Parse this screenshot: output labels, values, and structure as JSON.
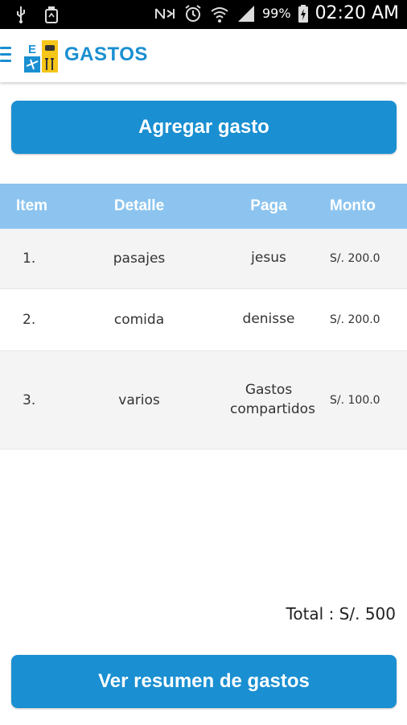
{
  "status_bar": {
    "battery_percent": "99%",
    "time": "02:20 AM",
    "icons": [
      "usb-icon",
      "recycle-icon",
      "nfc-icon",
      "alarm-icon",
      "wifi-icon",
      "signal-icon",
      "battery-icon"
    ]
  },
  "app_bar": {
    "title": "GASTOS",
    "logo_letter": "E",
    "accent_color": "#1a8fd1"
  },
  "actions": {
    "add_label": "Agregar gasto",
    "summary_label": "Ver resumen de gastos"
  },
  "table": {
    "header_color": "#8cc4ef",
    "headers": {
      "item": "Item",
      "detalle": "Detalle",
      "paga": "Paga",
      "monto": "Monto"
    },
    "rows": [
      {
        "item": "1.",
        "detalle": "pasajes",
        "paga": "jesus",
        "monto": "S/. 200.0"
      },
      {
        "item": "2.",
        "detalle": "comida",
        "paga": "denisse",
        "monto": "S/. 200.0"
      },
      {
        "item": "3.",
        "detalle": "varios",
        "paga": "Gastos compartidos",
        "monto": "S/. 100.0"
      }
    ]
  },
  "total": {
    "label": "Total : S/. 500"
  }
}
